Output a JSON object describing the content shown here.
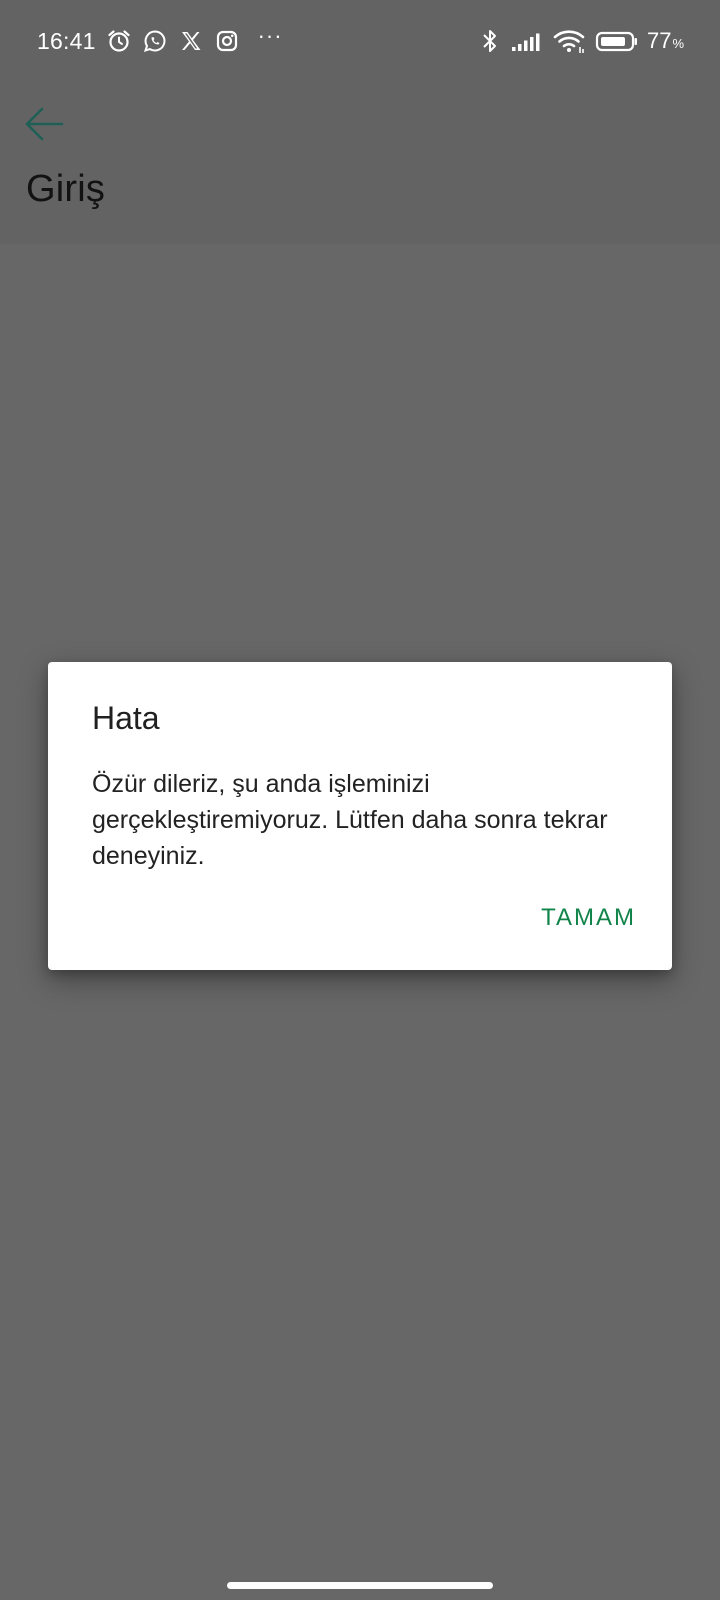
{
  "status_bar": {
    "time": "16:41",
    "battery_value": "77",
    "battery_unit": "%",
    "left_icons": [
      "alarm-clock-icon",
      "whatsapp-icon",
      "x-twitter-icon",
      "instagram-icon"
    ],
    "overflow": "···",
    "right_icons": [
      "bluetooth-icon",
      "signal-icon",
      "wifi-icon",
      "battery-icon"
    ]
  },
  "app_bar": {
    "back_icon": "arrow-left-icon",
    "title": "Giriş"
  },
  "dialog": {
    "title": "Hata",
    "message": "Özür dileriz, şu anda işleminizi gerçekleştiremiyoruz. Lütfen daha sonra tekrar deneyiniz.",
    "ok_label": "TAMAM"
  },
  "colors": {
    "scrim": "#676767",
    "accent": "#11844a",
    "back_arrow": "#1f5f55",
    "dialog_bg": "#ffffff"
  }
}
